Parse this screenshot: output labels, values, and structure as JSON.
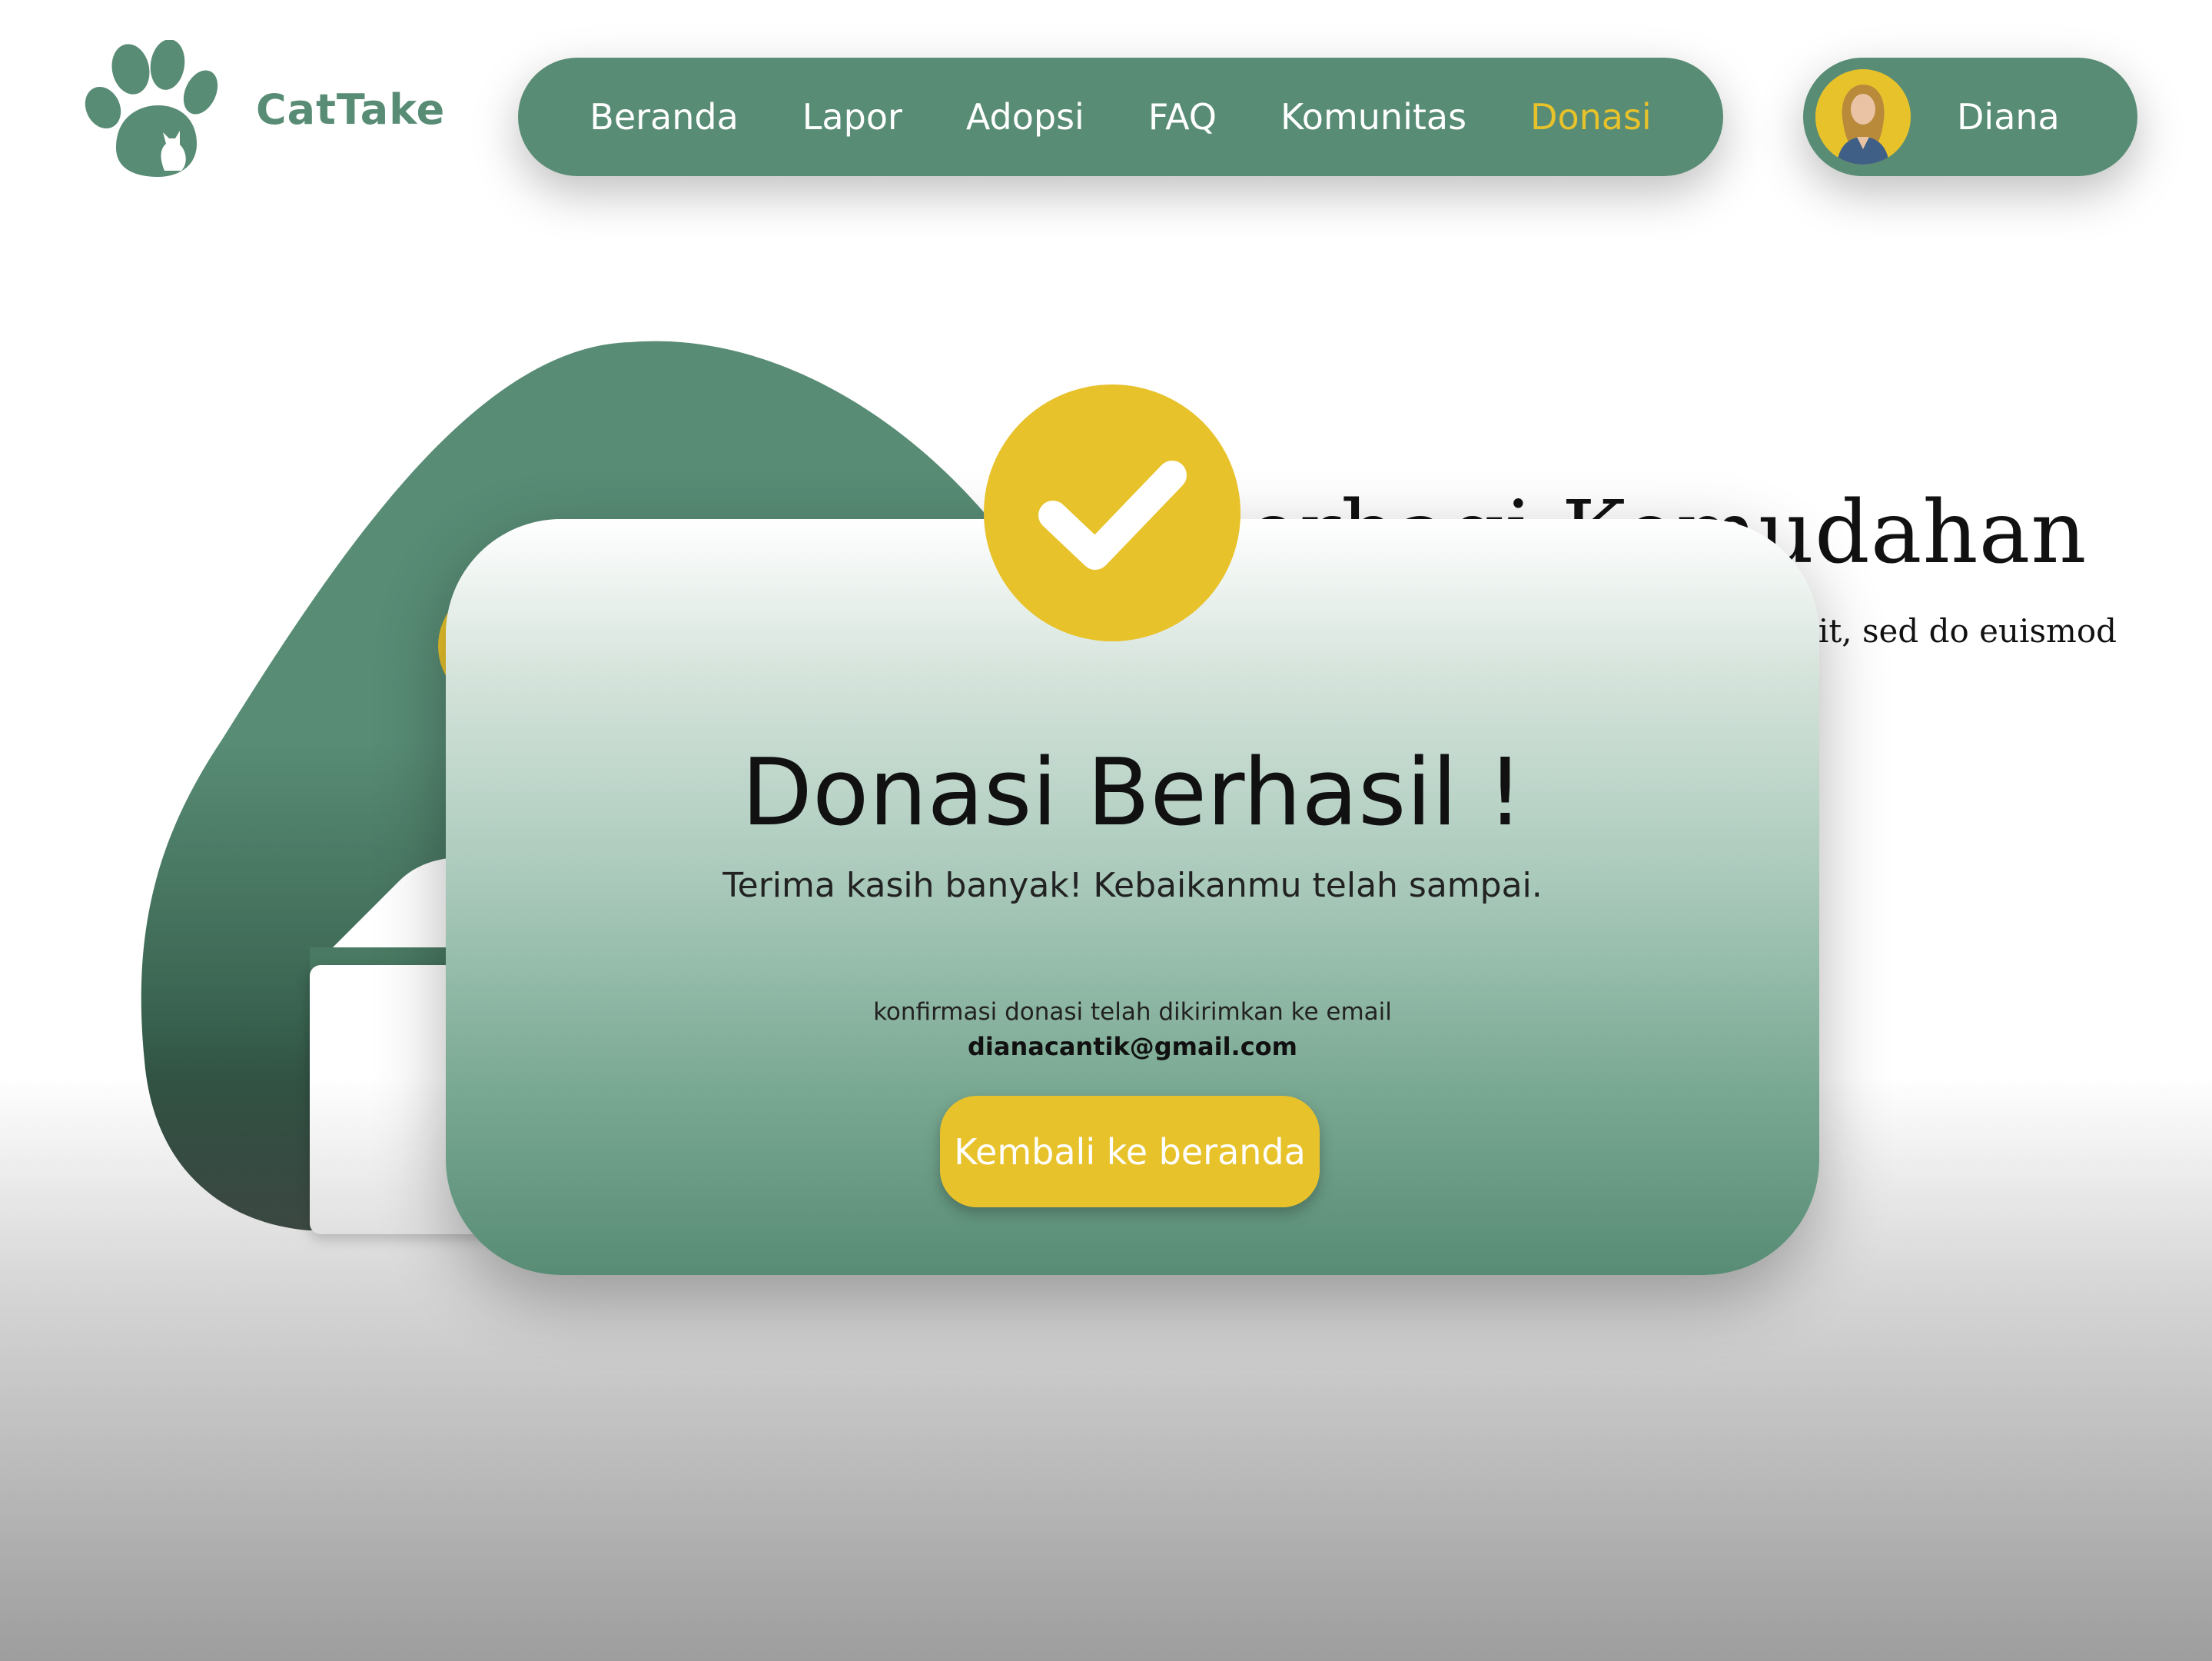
{
  "brand": {
    "name": "CatTake",
    "logo_icon": "paw-cat-icon",
    "color": "#588c75"
  },
  "nav": {
    "items": [
      {
        "label": "Beranda",
        "active": false
      },
      {
        "label": "Lapor",
        "active": false
      },
      {
        "label": "Adopsi",
        "active": false
      },
      {
        "label": "FAQ",
        "active": false
      },
      {
        "label": "Komunitas",
        "active": false
      },
      {
        "label": "Donasi",
        "active": true
      }
    ],
    "background": "#588c75",
    "active_color": "#e8c22b"
  },
  "user": {
    "name": "Diana",
    "avatar_icon": "user-avatar"
  },
  "hero": {
    "title": "Berbagi Kemudahan",
    "subtitle": "elit, sed do euismod"
  },
  "modal": {
    "icon": "checkmark-icon",
    "title": "Donasi Berhasil !",
    "subtitle": "Terima kasih banyak! Kebaikanmu telah sampai.",
    "note": "konfirmasi donasi telah dikirimkan ke email",
    "email": "dianacantik@gmail.com",
    "button_label": "Kembali ke beranda",
    "accent": "#e8c22b"
  }
}
